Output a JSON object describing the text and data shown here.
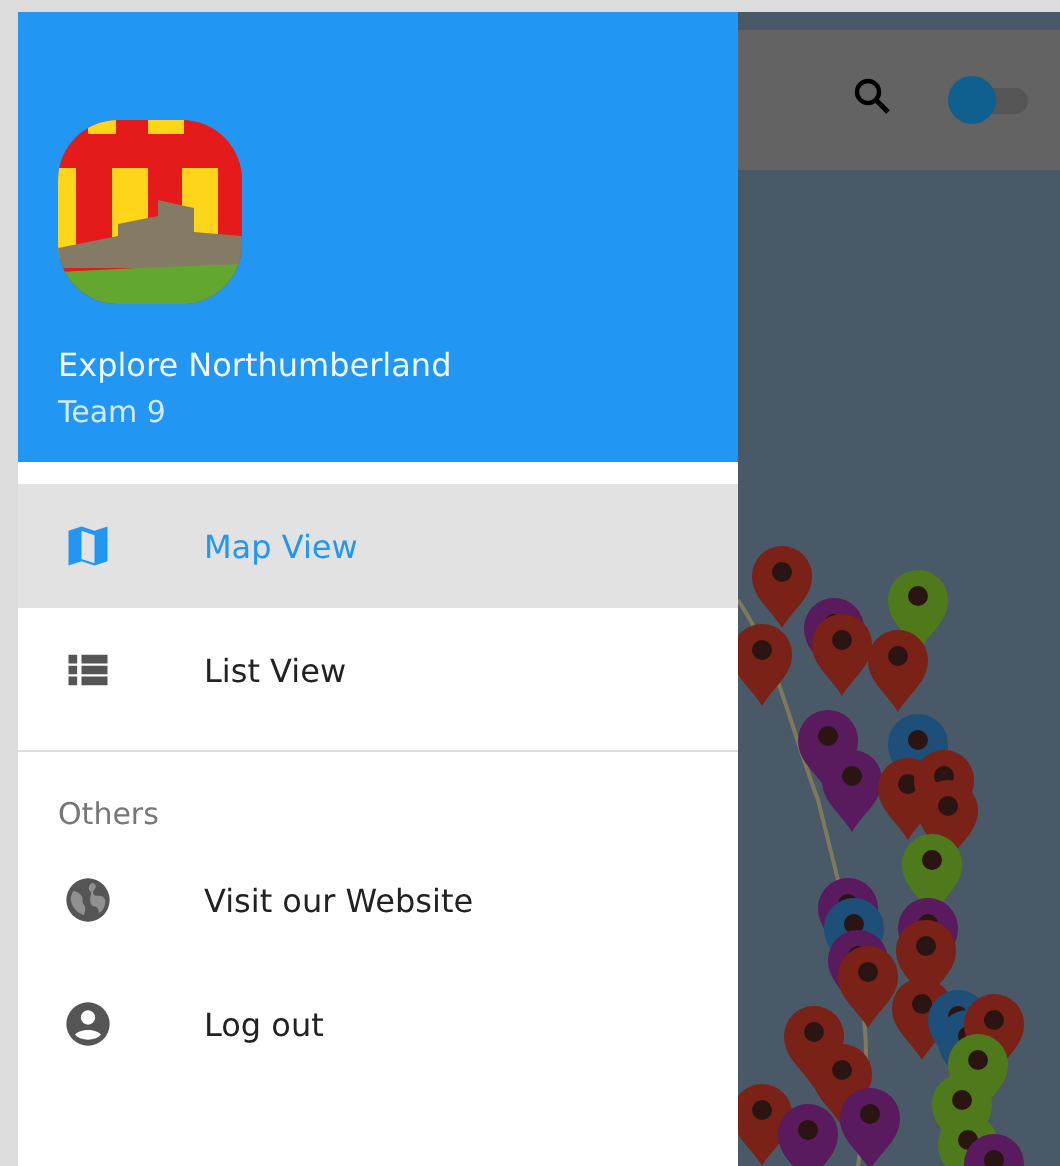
{
  "drawer": {
    "app_name": "Explore Northumberland",
    "subtitle": "Team 9",
    "items": [
      {
        "label": "Map View",
        "kind": "map",
        "selected": true
      },
      {
        "label": "List View",
        "kind": "list",
        "selected": false
      }
    ],
    "section": {
      "title": "Others",
      "items": [
        {
          "label": "Visit our Website",
          "kind": "globe",
          "selected": false
        },
        {
          "label": "Log out",
          "kind": "account",
          "selected": false
        }
      ]
    }
  },
  "toolbar": {
    "toggle": {
      "on": false
    }
  }
}
